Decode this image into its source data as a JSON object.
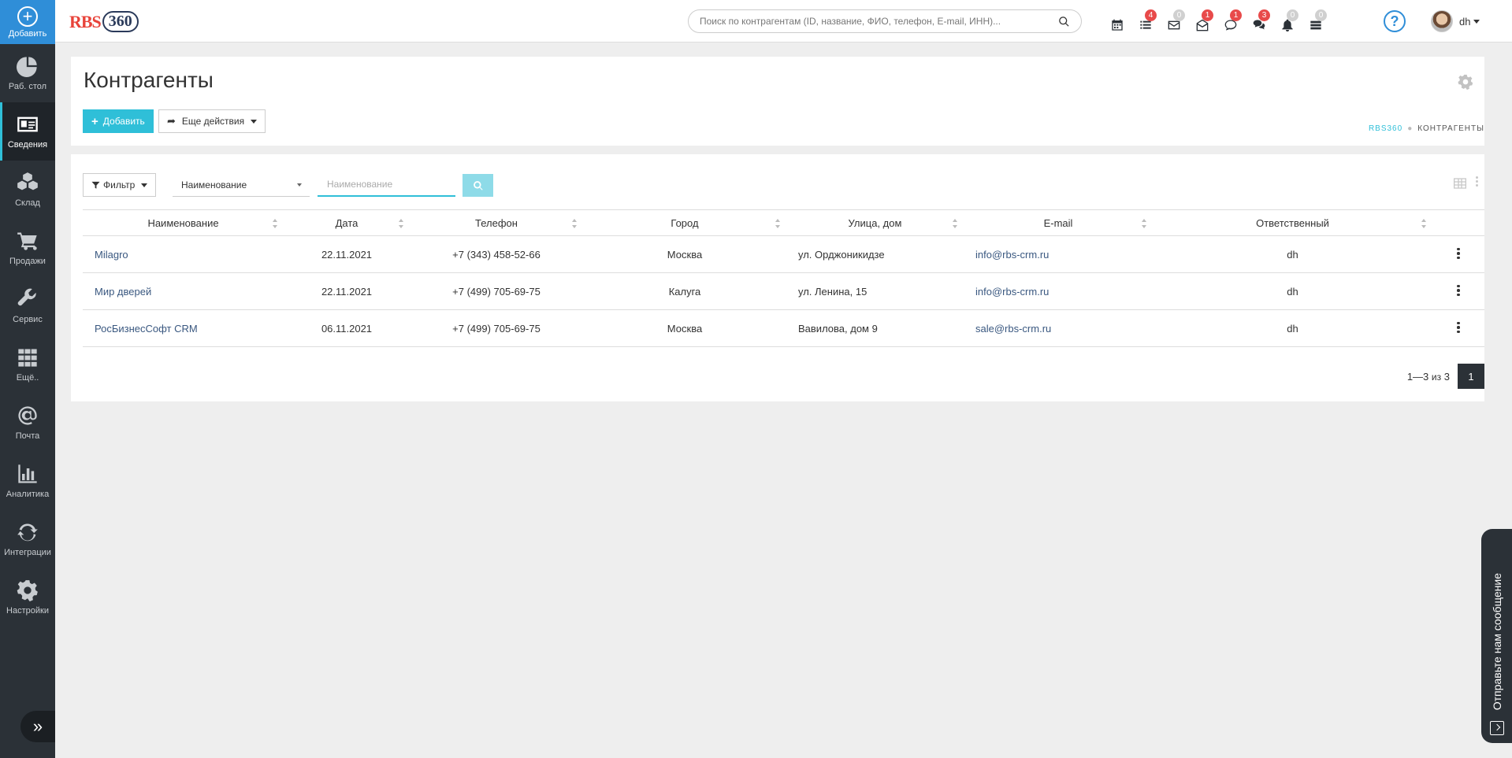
{
  "sidebar": {
    "add_label": "Добавить",
    "items": [
      {
        "label": "Раб. стол",
        "icon": "pie-chart-icon"
      },
      {
        "label": "Сведения",
        "icon": "id-card-icon",
        "active": true
      },
      {
        "label": "Склад",
        "icon": "cubes-icon"
      },
      {
        "label": "Продажи",
        "icon": "cart-icon"
      },
      {
        "label": "Сервис",
        "icon": "wrench-icon"
      },
      {
        "label": "Ещё..",
        "icon": "grid-icon"
      },
      {
        "label": "Почта",
        "icon": "at-icon"
      },
      {
        "label": "Аналитика",
        "icon": "bar-chart-icon"
      },
      {
        "label": "Интеграции",
        "icon": "refresh-icon"
      },
      {
        "label": "Настройки",
        "icon": "gear-icon"
      }
    ]
  },
  "header": {
    "logo_left": "RBS",
    "logo_right": "360",
    "search_placeholder": "Поиск по контрагентам (ID, название, ФИО, телефон, E-mail, ИНН)...",
    "badges": {
      "calendar": "",
      "tasks": "4",
      "mail": "0",
      "inbox": "1",
      "chat": "1",
      "comments": "3",
      "notifications": "0",
      "stack": "0"
    },
    "help": "?",
    "user_name": "dh"
  },
  "page": {
    "title": "Контрагенты",
    "add_button": "Добавить",
    "more_actions": "Еще действия",
    "breadcrumb": [
      "RBS360",
      "Контрагенты"
    ]
  },
  "filters": {
    "filter_button": "Фильтр",
    "field_selected": "Наименование",
    "search_placeholder": "Наименование"
  },
  "table": {
    "columns": [
      "Наименование",
      "Дата",
      "Телефон",
      "Город",
      "Улица, дом",
      "E-mail",
      "Ответственный"
    ],
    "rows": [
      {
        "name": "Milagro",
        "date": "22.11.2021",
        "phone": "+7 (343) 458-52-66",
        "city": "Москва",
        "street": "ул. Орджоникидзе",
        "email": "info@rbs-crm.ru",
        "responsible": "dh"
      },
      {
        "name": "Мир дверей",
        "date": "22.11.2021",
        "phone": "+7 (499) 705-69-75",
        "city": "Калуга",
        "street": "ул. Ленина, 15",
        "email": "info@rbs-crm.ru",
        "responsible": "dh"
      },
      {
        "name": "РосБизнесСофт CRM",
        "date": "06.11.2021",
        "phone": "+7 (499) 705-69-75",
        "city": "Москва",
        "street": "Вавилова, дом 9",
        "email": "sale@rbs-crm.ru",
        "responsible": "dh"
      }
    ]
  },
  "pagination": {
    "range": "1—3",
    "of_label": "из",
    "total": "3",
    "current_page": "1"
  },
  "feedback": {
    "label": "Отправьте нам сообщение"
  },
  "colors": {
    "sidebar_bg": "#2b3137",
    "accent": "#2fbfd8",
    "add_blue": "#2f8ed8",
    "badge_red": "#e84a4a",
    "link": "#3a5880"
  }
}
